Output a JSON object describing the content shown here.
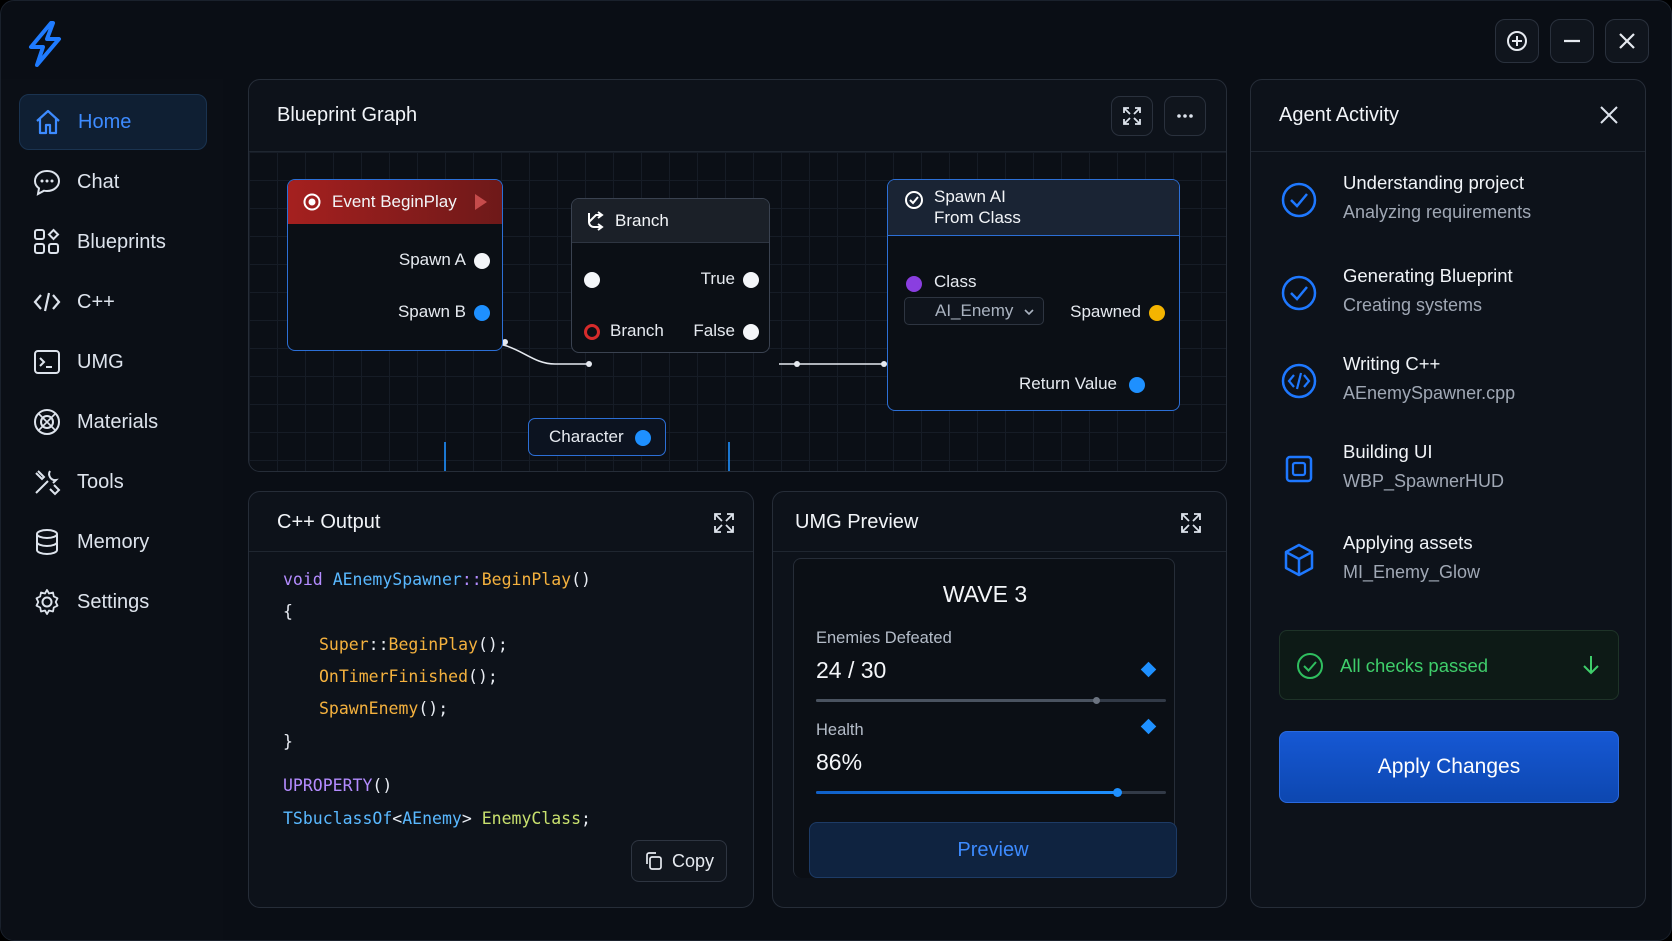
{
  "window": {
    "buttons": [
      "add-icon",
      "minimize-icon",
      "close-icon"
    ]
  },
  "sidebar": {
    "items": [
      {
        "label": "Home",
        "icon": "home-icon",
        "active": true
      },
      {
        "label": "Chat",
        "icon": "chat-icon"
      },
      {
        "label": "Blueprints",
        "icon": "blueprints-icon"
      },
      {
        "label": "C++",
        "icon": "code-icon"
      },
      {
        "label": "UMG",
        "icon": "terminal-icon"
      },
      {
        "label": "Materials",
        "icon": "materials-icon"
      },
      {
        "label": "Tools",
        "icon": "tools-icon"
      },
      {
        "label": "Memory",
        "icon": "database-icon"
      },
      {
        "label": "Settings",
        "icon": "gear-icon"
      }
    ]
  },
  "blueprint": {
    "title": "Blueprint Graph",
    "event_node": {
      "title": "Event BeginPlay",
      "pin_a": "Spawn A",
      "pin_b": "Spawn B"
    },
    "branch_node": {
      "title": "Branch",
      "true_label": "True",
      "false_label": "False",
      "condition_label": "Branch"
    },
    "spawn_node": {
      "title_line1": "Spawn AI",
      "title_line2": "From Class",
      "class_label": "Class",
      "class_value": "AI_Enemy",
      "spawned_label": "Spawned",
      "return_label": "Return Value"
    },
    "character_node": {
      "title": "Character"
    }
  },
  "cpp": {
    "title": "C++ Output",
    "copy_label": "Copy",
    "lines": {
      "l1_kw": "void",
      "l1_ty": "AEnemySpawner",
      "l1_sep": "::",
      "l1_fn": "BeginPlay",
      "l1_end": "()",
      "l2": "{",
      "l3_a": "Super",
      "l3_sep": "::",
      "l3_fn": "BeginPlay",
      "l3_end": "();",
      "l4_fn": "OnTimerFinished",
      "l4_end": "();",
      "l5_fn": "SpawnEnemy",
      "l5_end": "();",
      "l6": "}",
      "l7_kw": "UPROPERTY",
      "l7_end": "()",
      "l8_ty": "TSbuclassOf",
      "l8_lt": "<",
      "l8_ty2": "AEnemy",
      "l8_gt": ">",
      "l8_var": "EnemyClass",
      "l8_end": ";"
    }
  },
  "umg": {
    "title": "UMG Preview",
    "wave": "WAVE 3",
    "enemies_label": "Enemies Defeated",
    "enemies_value": "24 / 30",
    "enemies_fraction": 0.8,
    "health_label": "Health",
    "health_value": "86%",
    "health_fraction": 0.86,
    "preview_label": "Preview"
  },
  "agent": {
    "title": "Agent Activity",
    "items": [
      {
        "title": "Understanding project",
        "sub": "Analyzing requirements",
        "icon": "check-circle-icon"
      },
      {
        "title": "Generating Blueprint",
        "sub": "Creating systems",
        "icon": "check-circle-icon"
      },
      {
        "title": "Writing C++",
        "sub": "AEnemySpawner.cpp",
        "icon": "code-circle-icon"
      },
      {
        "title": "Building UI",
        "sub": "WBP_SpawnerHUD",
        "icon": "ui-widget-icon"
      },
      {
        "title": "Applying assets",
        "sub": "MI_Enemy_Glow",
        "icon": "cube-icon"
      }
    ],
    "checks_label": "All checks passed",
    "apply_label": "Apply Changes"
  }
}
